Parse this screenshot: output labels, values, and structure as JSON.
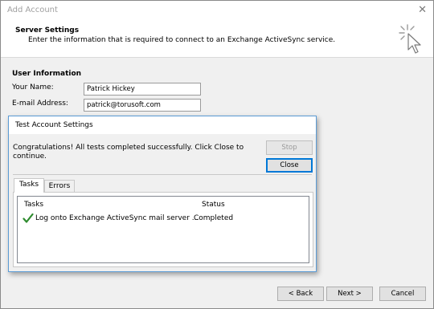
{
  "window": {
    "title": "Add Account",
    "close_glyph": "✕"
  },
  "header": {
    "title": "Server Settings",
    "subtitle": "Enter the information that is required to connect to an Exchange ActiveSync service.",
    "icon": "cursor-sparkle-icon"
  },
  "user_info": {
    "section_title": "User Information",
    "name_label": "Your Name:",
    "name_value": "Patrick Hickey",
    "email_label": "E-mail Address:",
    "email_value": "patrick@torusoft.com"
  },
  "dialog": {
    "title": "Test Account Settings",
    "message": "Congratulations! All tests completed successfully. Click Close to continue.",
    "stop_label": "Stop",
    "close_label": "Close",
    "tabs": [
      {
        "label": "Tasks"
      },
      {
        "label": "Errors"
      }
    ],
    "columns": {
      "tasks": "Tasks",
      "status": "Status"
    },
    "rows": [
      {
        "task": "Log onto Exchange ActiveSync mail server ...",
        "status": "Completed"
      }
    ]
  },
  "footer": {
    "back_label": "< Back",
    "next_label": "Next >",
    "cancel_label": "Cancel"
  },
  "colors": {
    "accent": "#0078d7",
    "check_green": "#2e8b2e"
  }
}
